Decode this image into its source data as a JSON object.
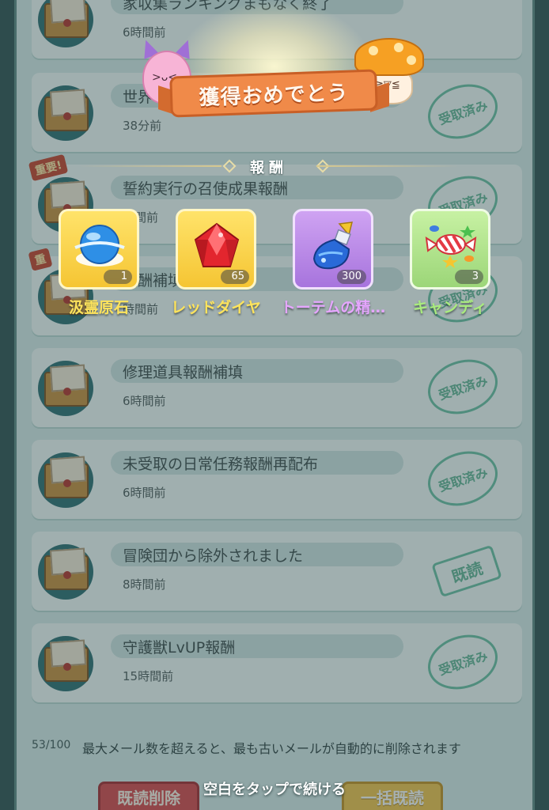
{
  "mail": {
    "items": [
      {
        "title": "家収集ランキングまもなく終了",
        "time": "6時間前",
        "stamp": ""
      },
      {
        "title": "世界",
        "time": "38分前",
        "stamp": "受取済み"
      },
      {
        "title": "誓約実行の召使成果報酬",
        "time": "時間前",
        "stamp": "受取済み",
        "tag": "重要!"
      },
      {
        "title": "報酬補填",
        "time": "時間前",
        "stamp": "受取済み",
        "tag": "重"
      },
      {
        "title": "修理道具報酬補填",
        "time": "6時間前",
        "stamp": "受取済み"
      },
      {
        "title": "未受取の日常任務報酬再配布",
        "time": "6時間前",
        "stamp": "受取済み"
      },
      {
        "title": "冒険団から除外されました",
        "time": "8時間前",
        "stamp": "既読"
      },
      {
        "title": "守護獣LvUP報酬",
        "time": "15時間前",
        "stamp": "受取済み"
      }
    ],
    "count": "53/100",
    "limit_note": "最大メール数を超えると、最も古いメールが自動的に削除されます",
    "delete_read_label": "既読削除",
    "read_all_label": "一括既読"
  },
  "popup": {
    "banner": "獲得おめでとう",
    "section_label": "報酬",
    "rewards": [
      {
        "name": "汲霊原石",
        "qty": "1",
        "name_color": "#ffe45c"
      },
      {
        "name": "レッドダイヤ",
        "qty": "65",
        "name_color": "#ffe45c"
      },
      {
        "name": "トーテムの精…",
        "qty": "300",
        "name_color": "#e6a6ff"
      },
      {
        "name": "キャンディ",
        "qty": "3",
        "name_color": "#a9ec7e"
      }
    ],
    "continue_hint": "空白をタップで続ける"
  }
}
